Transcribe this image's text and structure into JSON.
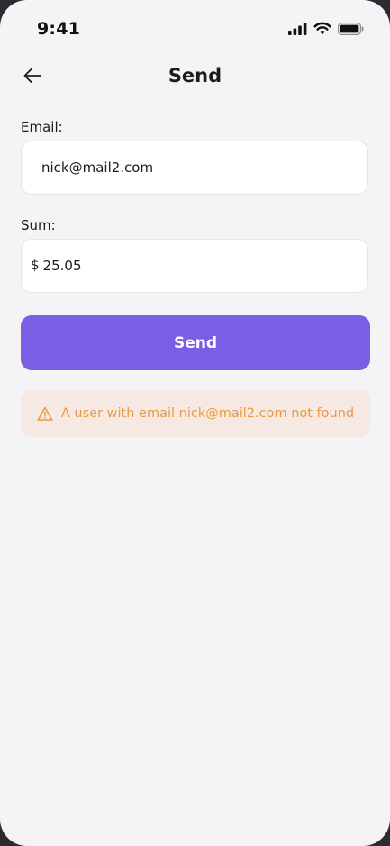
{
  "status_bar": {
    "time": "9:41",
    "icons": [
      "cellular-signal-icon",
      "wifi-icon",
      "battery-icon"
    ]
  },
  "header": {
    "title": "Send",
    "back_icon": "arrow-left-icon"
  },
  "form": {
    "email_label": "Email:",
    "email_value": "nick@mail2.com",
    "sum_label": "Sum:",
    "currency_symbol": "$",
    "sum_value": "25.05"
  },
  "actions": {
    "send_label": "Send"
  },
  "alert": {
    "icon": "warning-triangle-icon",
    "message": "A user with email nick@mail2.com not found"
  },
  "colors": {
    "background": "#f4f4f6",
    "accent": "#7a5fe4",
    "warning_text": "#e99a3e",
    "warning_background": "#f6e9e3"
  }
}
